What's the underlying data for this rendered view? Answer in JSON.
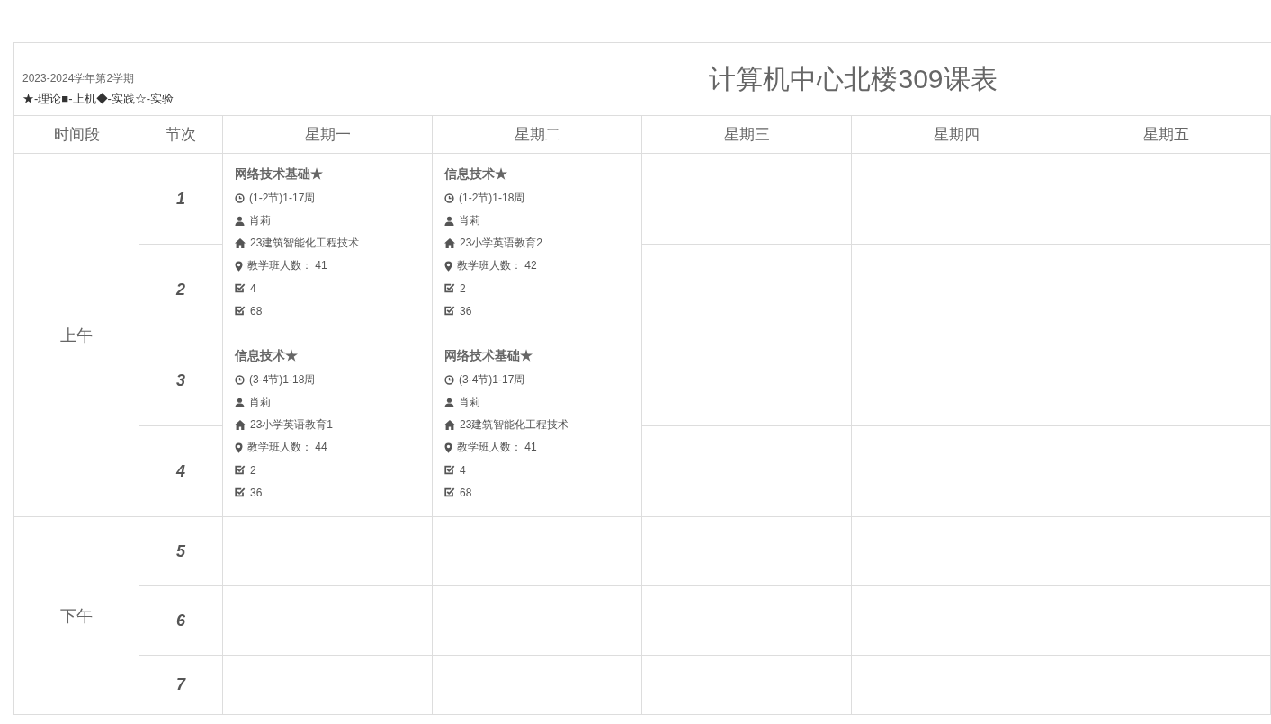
{
  "semester": "2023-2024学年第2学期",
  "legend": "★-理论■-上机◆-实践☆-实验",
  "title": "计算机中心北楼309课表",
  "columns": [
    "时间段",
    "节次",
    "星期一",
    "星期二",
    "星期三",
    "星期四",
    "星期五"
  ],
  "sessions": [
    {
      "label": "上午",
      "periods": [
        "1",
        "2",
        "3",
        "4"
      ],
      "blocks": [
        {
          "cells": [
            {
              "name": "网络技术基础★",
              "time": "(1-2节)1-17周",
              "teacher": "肖莉",
              "class": "23建筑智能化工程技术",
              "count": "教学班人数： 41",
              "checks": [
                "4",
                "68"
              ]
            },
            {
              "name": "信息技术★",
              "time": "(1-2节)1-18周",
              "teacher": "肖莉",
              "class": "23小学英语教育2",
              "count": "教学班人数： 42",
              "checks": [
                "2",
                "36"
              ]
            },
            null,
            null,
            null
          ]
        },
        {
          "cells": [
            {
              "name": "信息技术★",
              "time": "(3-4节)1-18周",
              "teacher": "肖莉",
              "class": "23小学英语教育1",
              "count": "教学班人数： 44",
              "checks": [
                "2",
                "36"
              ]
            },
            {
              "name": "网络技术基础★",
              "time": "(3-4节)1-17周",
              "teacher": "肖莉",
              "class": "23建筑智能化工程技术",
              "count": "教学班人数： 41",
              "checks": [
                "4",
                "68"
              ]
            },
            null,
            null,
            null
          ]
        }
      ]
    },
    {
      "label": "下午",
      "periods": [
        "5",
        "6",
        "7"
      ]
    }
  ]
}
